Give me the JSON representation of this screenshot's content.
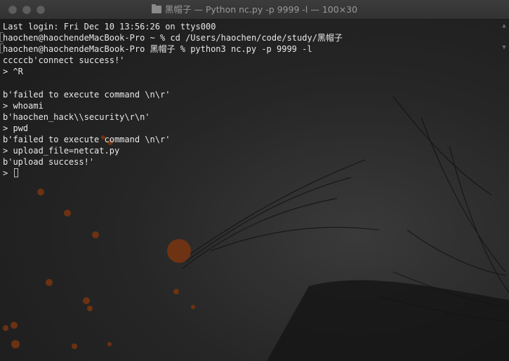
{
  "window": {
    "title": "黑帽子 — Python nc.py -p 9999 -l — 100×30",
    "colors": {
      "titlebar": "#363636",
      "text": "#e8e8e8",
      "traffic_light": "#5e5e5e"
    }
  },
  "terminal": {
    "lines": [
      "Last login: Fri Dec 10 13:56:26 on ttys000",
      "haochen@haochendeMacBook-Pro ~ % cd /Users/haochen/code/study/黑帽子",
      "haochen@haochendeMacBook-Pro 黑帽子 % python3 nc.py -p 9999 -l",
      "cccccb'connect success!'",
      "> ^R",
      "",
      "b'failed to execute command \\n\\r'",
      "> whoami",
      "b'haochen_hack\\\\security\\r\\n'",
      "> pwd",
      "b'failed to execute command \\n\\r'",
      "> upload_file=netcat.py",
      "b'upload success!'"
    ],
    "prompt": ">"
  },
  "icons": {
    "window_icon": "folder-icon",
    "scroll_up": "scroll-up-icon",
    "scroll_down": "scroll-down-icon"
  }
}
